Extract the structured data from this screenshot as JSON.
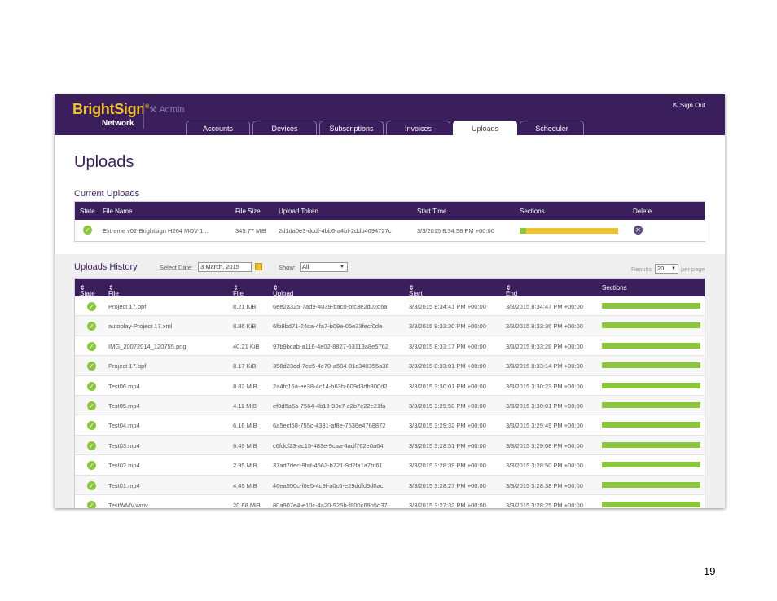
{
  "header": {
    "logo_text": "BrightSign",
    "logo_mark": "®",
    "network_label": "Network",
    "admin_label": "Admin",
    "sign_out": "Sign Out",
    "brand_color": "#3a1f5c",
    "accent_color": "#f0c22e"
  },
  "tabs": [
    {
      "label": "Accounts"
    },
    {
      "label": "Devices"
    },
    {
      "label": "Subscriptions"
    },
    {
      "label": "Invoices"
    },
    {
      "label": "Uploads"
    },
    {
      "label": "Scheduler"
    }
  ],
  "page_title": "Uploads",
  "current_uploads": {
    "title": "Current Uploads",
    "columns": [
      "State",
      "File Name",
      "File Size",
      "Upload Token",
      "Start Time",
      "Sections",
      "Delete"
    ],
    "rows": [
      {
        "state_icon": "check-icon",
        "file_name": "Extreme v02-Brightsign H264 MOV 1...",
        "file_size": "345.77 MiB",
        "upload_token": "2d1da0e3-dcdf-4bb6-a4bf-2ddb4694727c",
        "start_time": "3/3/2015 8:34:58 PM +00:00",
        "sections_progress": 0.07,
        "delete_icon": "close-icon"
      }
    ]
  },
  "uploads_history": {
    "title": "Uploads History",
    "select_date_label": "Select Date:",
    "select_date_value": "3 March, 2015",
    "show_label": "Show:",
    "show_value": "All",
    "results_label": "Results",
    "results_value": "20",
    "per_page_label": "per page",
    "columns": [
      "State",
      "File Name",
      "File Size",
      "Upload Token",
      "Start Time",
      "End Time",
      "Sections"
    ],
    "rows": [
      {
        "file_name": "Project 17.bpf",
        "file_size": "8.21 KiB",
        "upload_token": "6ee2a325-7ad9-4039-bac0-bfc3e2d02d6a",
        "start_time": "3/3/2015 8:34:41 PM +00:00",
        "end_time": "3/3/2015 8:34:47 PM +00:00",
        "sections_progress": 1.0
      },
      {
        "file_name": "autoplay-Project 17.xml",
        "file_size": "8.86 KiB",
        "upload_token": "6fb9bd71-24ca-4fa7-b09e-05e33fecf0de",
        "start_time": "3/3/2015 8:33:30 PM +00:00",
        "end_time": "3/3/2015 8:33:36 PM +00:00",
        "sections_progress": 1.0
      },
      {
        "file_name": "IMG_20072014_120755.png",
        "file_size": "40.21 KiB",
        "upload_token": "97b9bcab-a116-4e02-8827-63113a8e5762",
        "start_time": "3/3/2015 8:33:17 PM +00:00",
        "end_time": "3/3/2015 8:33:28 PM +00:00",
        "sections_progress": 1.0
      },
      {
        "file_name": "Project 17.bpf",
        "file_size": "8.17 KiB",
        "upload_token": "358d23dd-7ec5-4e70-a584-81c340355a38",
        "start_time": "3/3/2015 8:33:01 PM +00:00",
        "end_time": "3/3/2015 8:33:14 PM +00:00",
        "sections_progress": 1.0
      },
      {
        "file_name": "Test06.mp4",
        "file_size": "8.82 MiB",
        "upload_token": "2a4fc16a-ee38-4c14-b63b-609d3db300d2",
        "start_time": "3/3/2015 3:30:01 PM +00:00",
        "end_time": "3/3/2015 3:30:23 PM +00:00",
        "sections_progress": 1.0
      },
      {
        "file_name": "Test05.mp4",
        "file_size": "4.11 MiB",
        "upload_token": "ef0d5a6a-7564-4b19-90c7-c2b7e22e21fa",
        "start_time": "3/3/2015 3:29:50 PM +00:00",
        "end_time": "3/3/2015 3:30:01 PM +00:00",
        "sections_progress": 1.0
      },
      {
        "file_name": "Test04.mp4",
        "file_size": "6.16 MiB",
        "upload_token": "6a5ecf68-755c-4381-af8e-7536e4768872",
        "start_time": "3/3/2015 3:29:32 PM +00:00",
        "end_time": "3/3/2015 3:29:49 PM +00:00",
        "sections_progress": 1.0
      },
      {
        "file_name": "Test03.mp4",
        "file_size": "6.49 MiB",
        "upload_token": "c6fdcf23-ac15-483e-9caa-4adf762e0a64",
        "start_time": "3/3/2015 3:28:51 PM +00:00",
        "end_time": "3/3/2015 3:29:08 PM +00:00",
        "sections_progress": 1.0
      },
      {
        "file_name": "Test02.mp4",
        "file_size": "2.95 MiB",
        "upload_token": "37ad7dec-9faf-4562-b721-9d2fa1a7bf61",
        "start_time": "3/3/2015 3:28:39 PM +00:00",
        "end_time": "3/3/2015 3:28:50 PM +00:00",
        "sections_progress": 1.0
      },
      {
        "file_name": "Test01.mp4",
        "file_size": "4.45 MiB",
        "upload_token": "46ea550c-f6e5-4c9f-a0c6-e29ddfd5d0ac",
        "start_time": "3/3/2015 3:28:27 PM +00:00",
        "end_time": "3/3/2015 3:28:38 PM +00:00",
        "sections_progress": 1.0
      },
      {
        "file_name": "TestWMV.wmv",
        "file_size": "20.68 MiB",
        "upload_token": "80a907e4-e10c-4a20-925b-f800c69b5d37",
        "start_time": "3/3/2015 3:27:32 PM +00:00",
        "end_time": "3/3/2015 3:28:25 PM +00:00",
        "sections_progress": 1.0
      }
    ]
  },
  "page_number": "19"
}
